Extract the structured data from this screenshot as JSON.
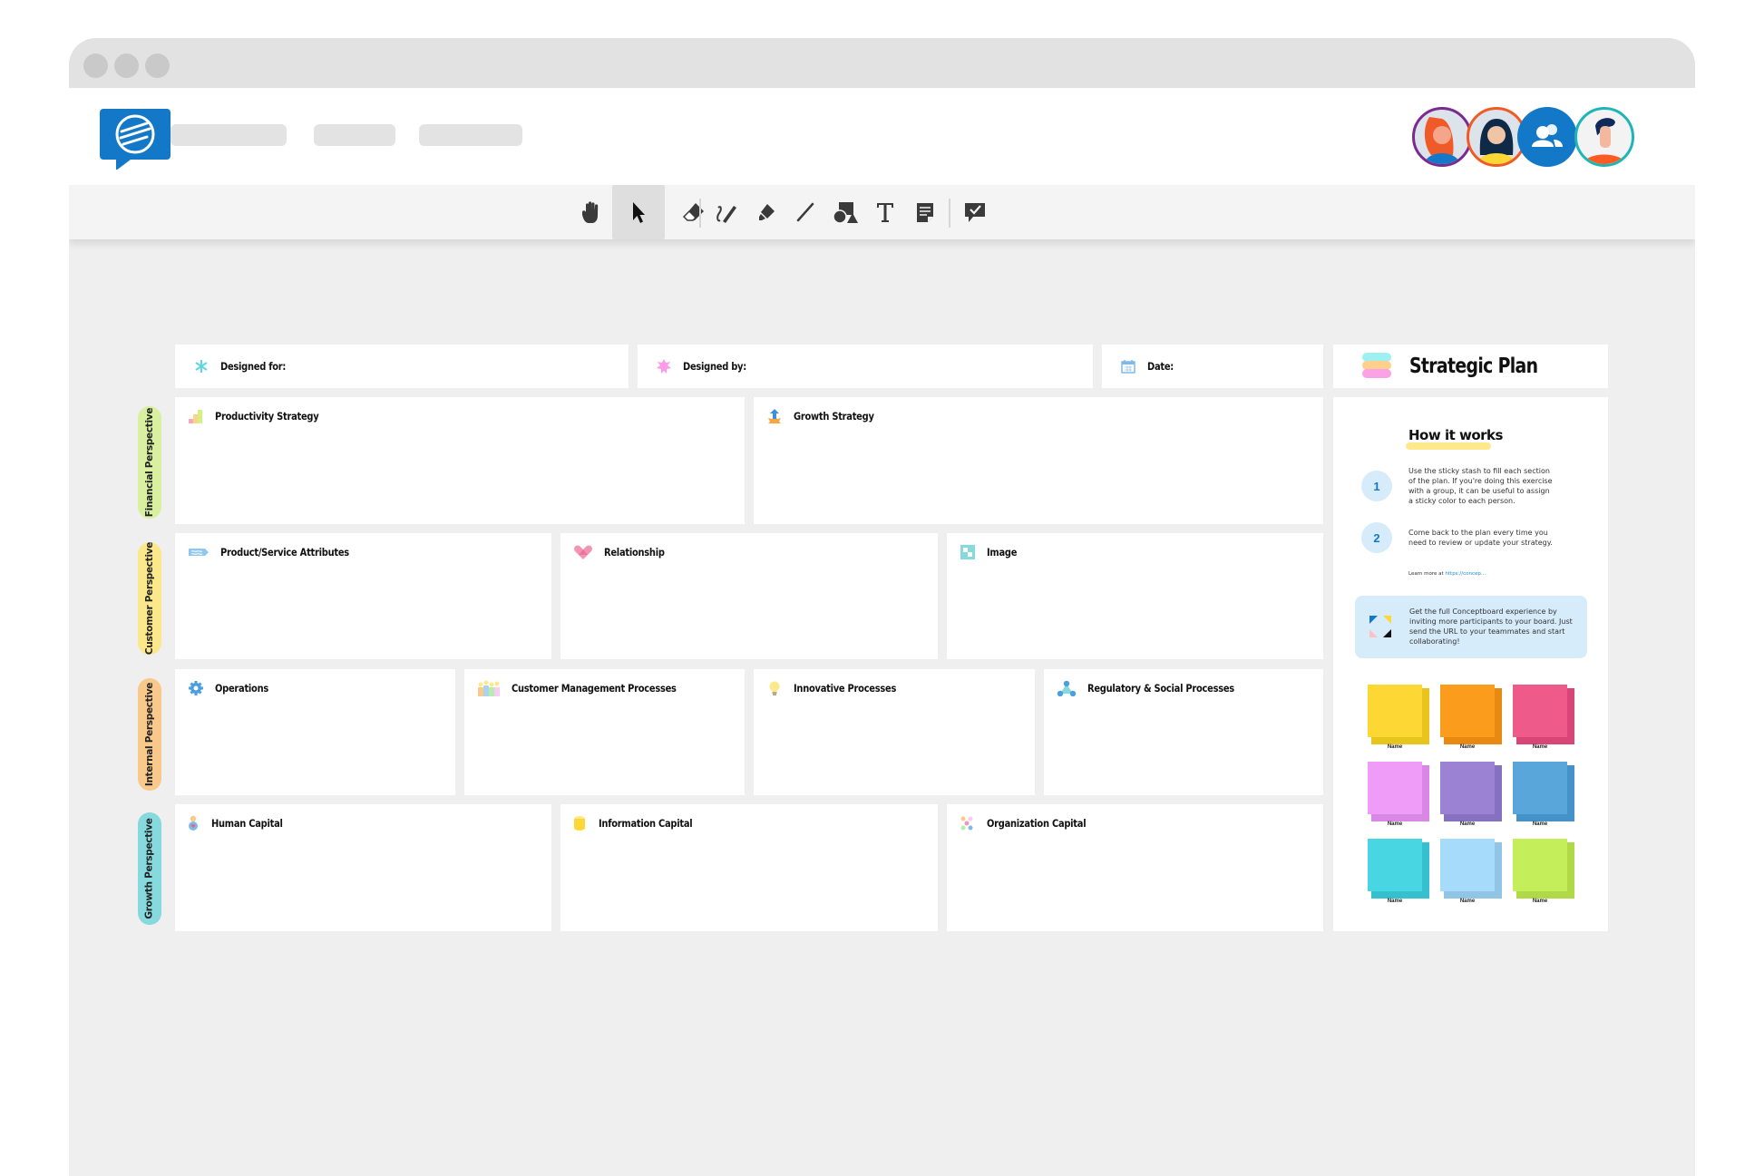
{
  "app": {
    "name": "Conceptboard",
    "brand_color": "#1478c8",
    "nav_placeholders": 3
  },
  "collaborators": [
    {
      "name": "collaborator-red-hair",
      "ring": "#7b2a8e"
    },
    {
      "name": "collaborator-dark-hair",
      "ring": "#f15a24"
    },
    {
      "name": "group-participants",
      "ring": "#1478c8"
    },
    {
      "name": "current-user",
      "ring": "#1eb5b5"
    }
  ],
  "toolbar": {
    "tools": [
      {
        "id": "hand",
        "label": "Hand tool",
        "active": false
      },
      {
        "id": "select",
        "label": "Select tool",
        "active": true
      },
      {
        "id": "eraser",
        "label": "Eraser"
      },
      {
        "id": "pen",
        "label": "Pen"
      },
      {
        "id": "highlighter",
        "label": "Highlighter"
      },
      {
        "id": "line",
        "label": "Line"
      },
      {
        "id": "shapes",
        "label": "Shapes"
      },
      {
        "id": "text",
        "label": "Text"
      },
      {
        "id": "sticky-note",
        "label": "Sticky note"
      },
      {
        "id": "comment",
        "label": "Comment / Review"
      }
    ]
  },
  "board": {
    "header": {
      "designed_for": "Designed for:",
      "designed_by": "Designed by:",
      "date": "Date:",
      "title": "Strategic Plan"
    },
    "perspectives": [
      {
        "label": "Financial Perspective",
        "color": "#d8f0a0"
      },
      {
        "label": "Customer Perspective",
        "color": "#fbe88a"
      },
      {
        "label": "Internal Perspective",
        "color": "#f8c98a"
      },
      {
        "label": "Growth Perspective",
        "color": "#86d9dc"
      }
    ],
    "sections": {
      "productivity_strategy": "Productivity Strategy",
      "growth_strategy": "Growth Strategy",
      "product_service_attributes": "Product/Service Attributes",
      "relationship": "Relationship",
      "image": "Image",
      "operations": "Operations",
      "customer_management_processes": "Customer Management Processes",
      "innovative_processes": "Innovative Processes",
      "regulatory_social_processes": "Regulatory & Social Processes",
      "human_capital": "Human Capital",
      "information_capital": "Information Capital",
      "organization_capital": "Organization Capital"
    }
  },
  "panel": {
    "how_it_works": "How it works",
    "steps": [
      {
        "num": "1",
        "text": "Use the sticky stash to fill each section of the plan. If you're doing this exercise with a group, it can be useful to assign a sticky color to each person."
      },
      {
        "num": "2",
        "text": "Come back to the plan every time you need to review or update your strategy."
      }
    ],
    "learn_more_prefix": "Learn more at ",
    "learn_more_link": "https://concep...",
    "info_text": "Get the full Conceptboard experience by inviting more participants to your board. Just send the URL to your teammates and start collaborating!",
    "stickies": [
      {
        "label": "Name",
        "color": "#fdd835",
        "shade": "#e8c51c"
      },
      {
        "label": "Name",
        "color": "#fb9c1d",
        "shade": "#e88a12"
      },
      {
        "label": "Name",
        "color": "#ee5a8a",
        "shade": "#d84677"
      },
      {
        "label": "Name",
        "color": "#ee9cf7",
        "shade": "#d887e4"
      },
      {
        "label": "Name",
        "color": "#9b82d3",
        "shade": "#8670c0"
      },
      {
        "label": "Name",
        "color": "#58a6da",
        "shade": "#4592c8"
      },
      {
        "label": "Name",
        "color": "#47d6e2",
        "shade": "#36bfcc"
      },
      {
        "label": "Name",
        "color": "#a6dbfb",
        "shade": "#90c5e6"
      },
      {
        "label": "Name",
        "color": "#c5ef5a",
        "shade": "#afd947"
      }
    ]
  }
}
